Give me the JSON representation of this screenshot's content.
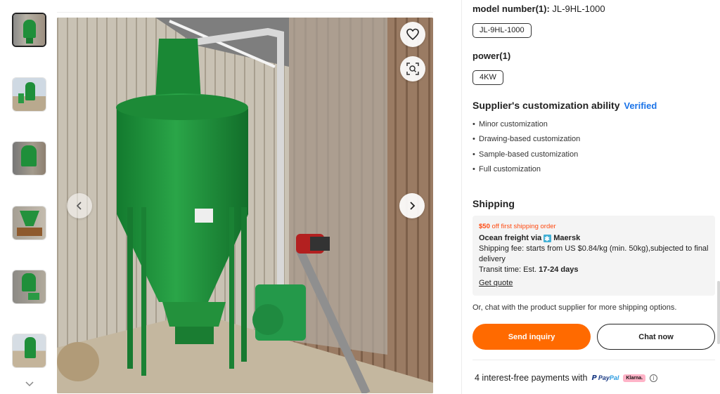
{
  "gallery": {
    "thumbnail_count": 6,
    "active_index": 0
  },
  "main_image": {
    "favorite_icon": "heart-outline-icon",
    "lens_icon": "image-search-icon",
    "prev_icon": "chevron-left-icon",
    "next_icon": "chevron-right-icon"
  },
  "attributes": {
    "model_label": "model number(1):",
    "model_value": "JL-9HL-1000",
    "model_chip": "JL-9HL-1000",
    "power_label": "power(1)",
    "power_chip": "4KW"
  },
  "customization": {
    "title": "Supplier's customization ability",
    "badge": "Verified",
    "items": [
      "Minor customization",
      "Drawing-based customization",
      "Sample-based customization",
      "Full customization"
    ]
  },
  "shipping": {
    "title": "Shipping",
    "promo_highlight": "$50",
    "promo_rest": "off first shipping order",
    "via_prefix": "Ocean freight via",
    "carrier": "Maersk",
    "fee_line": "Shipping fee: starts from US $0.84/kg (min. 50kg),subjected to final delivery",
    "transit_prefix": "Transit time: Est.",
    "transit_value": "17-24 days",
    "get_quote": "Get quote",
    "chat_note": "Or, chat with the product supplier for more shipping options."
  },
  "actions": {
    "send_inquiry": "Send inquiry",
    "chat_now": "Chat now"
  },
  "payments": {
    "text": "4 interest-free payments with",
    "paypal_pay": "Pay",
    "paypal_pal": "Pal",
    "klarna": "Klarna."
  },
  "colors": {
    "accent": "#ff6a00",
    "promo_red": "#ff4a11",
    "verified_blue": "#1a73e8",
    "machine_green": "#1f8f3a"
  }
}
